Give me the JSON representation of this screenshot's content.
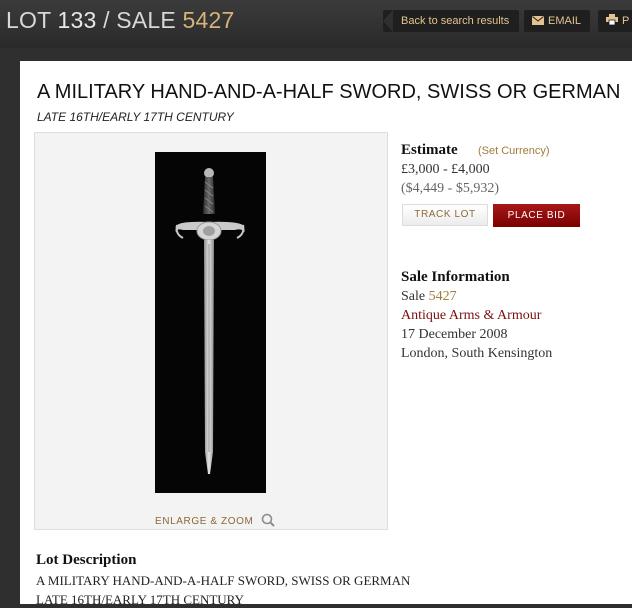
{
  "header": {
    "lot_prefix": "LOT",
    "lot_number": "133",
    "separator": "/",
    "sale_prefix": "SALE",
    "sale_number": "5427",
    "back_label": "Back to search results",
    "email_label": "EMAIL",
    "print_label": "P"
  },
  "lot": {
    "title": "A MILITARY HAND-AND-A-HALF SWORD, SWISS OR GERMAN",
    "subtitle": "LATE 16TH/EARLY 17TH CENTURY",
    "enlarge_label": "ENLARGE & ZOOM"
  },
  "estimate": {
    "heading": "Estimate",
    "set_currency": "(Set Currency)",
    "gbp": "£3,000 - £4,000",
    "usd": "($4,449 - $5,932)",
    "track_label": "TRACK LOT",
    "bid_label": "PLACE BID"
  },
  "sale_info": {
    "heading": "Sale Information",
    "sale_label": "Sale",
    "sale_number": "5427",
    "department": "Antique Arms & Armour",
    "date": "17 December 2008",
    "location": "London, South Kensington"
  },
  "description": {
    "heading": "Lot Description",
    "line1": "A MILITARY HAND-AND-A-HALF SWORD, SWISS OR GERMAN",
    "line2": "LATE 16TH/EARLY 17TH CENTURY"
  },
  "colors": {
    "accent_gold": "#d7b27a",
    "link_gold": "#a07c3e",
    "bid_red": "#8b0000",
    "background_dark": "#2f2f2f"
  },
  "icons": [
    "envelope-icon",
    "printer-icon",
    "magnifier-icon"
  ]
}
